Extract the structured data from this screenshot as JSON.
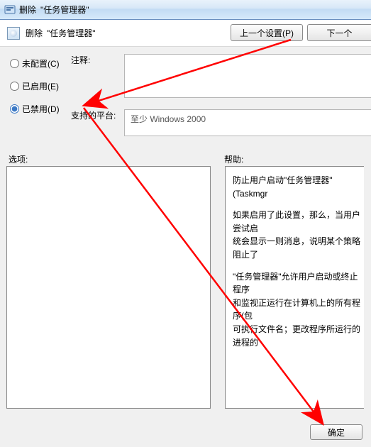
{
  "window": {
    "title": "删除 \"任务管理器\""
  },
  "header": {
    "title": "删除 \"任务管理器\"",
    "prev_button": "上一个设置(P)",
    "next_button": "下一个"
  },
  "radios": {
    "not_configured": "未配置(C)",
    "enabled": "已启用(E)",
    "disabled": "已禁用(D)",
    "selected": "disabled"
  },
  "labels": {
    "comment": "注释:",
    "platform": "支持的平台:",
    "options": "选项:",
    "help": "帮助:"
  },
  "platform_text": "至少 Windows 2000",
  "help_text": {
    "p1": "防止用户启动\"任务管理器\"(Taskmgr",
    "p2": "如果启用了此设置，那么，当用户尝试启\n统会显示一则消息，说明某个策略阻止了",
    "p3": "\"任务管理器\"允许用户启动或终止程序\n和监视正运行在计算机上的所有程序(包\n可执行文件名；更改程序所运行的进程的"
  },
  "footer": {
    "ok": "确定"
  },
  "colors": {
    "arrow": "#ff0000",
    "titlebar_start": "#e9f2fb",
    "titlebar_end": "#c2dbf3"
  }
}
